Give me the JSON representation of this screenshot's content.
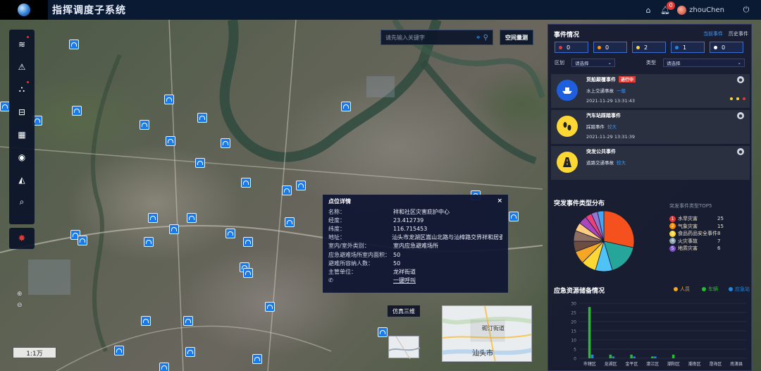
{
  "app": {
    "title": "指挥调度子系统",
    "user": "zhouChen",
    "notification_count": "0"
  },
  "search": {
    "placeholder": "请先输入关键字",
    "space_button": "空间量测"
  },
  "map": {
    "scale": "1:1万",
    "view_3d_button": "仿真三维",
    "minimap_city": "汕头市",
    "minimap_district": "砌汀街道"
  },
  "toolbar": {
    "tools": [
      "layers-icon",
      "warning-icon",
      "network-icon",
      "cabinet-icon",
      "grid-icon",
      "globe-icon",
      "camera-icon",
      "monitor-search-icon"
    ],
    "alarm": "alarm-icon"
  },
  "detail": {
    "title": "点位详情",
    "close": "×",
    "rows": [
      {
        "key": "名称：",
        "val": "祥和社区灾害庇护中心"
      },
      {
        "key": "经度：",
        "val": "23.412739"
      },
      {
        "key": "纬度：",
        "val": "116.715453"
      },
      {
        "key": "地址：",
        "val": "汕头市龙湖区嵩山北路与汕樟路交界祥和居委"
      },
      {
        "key": "室内/室外类别：",
        "val": "室内应急避难场所"
      },
      {
        "key": "应急避难场所室内面积：",
        "val": "50"
      },
      {
        "key": "避难所容纳人数：",
        "val": "50"
      },
      {
        "key": "主管单位：",
        "val": "龙祥街道"
      }
    ],
    "phone_link": "一键呼叫"
  },
  "events_panel": {
    "title": "事件情况",
    "tabs": [
      "当前事件",
      "历史事件"
    ],
    "stats": [
      {
        "value": "0",
        "color": "#e53935"
      },
      {
        "value": "0",
        "color": "#ff9800"
      },
      {
        "value": "2",
        "color": "#fdd835"
      },
      {
        "value": "1",
        "color": "#1e88e5"
      },
      {
        "value": "0",
        "color": "#ffffff"
      }
    ],
    "filter_region_label": "区划",
    "filter_type_label": "类型",
    "select_placeholder": "请选择",
    "events": [
      {
        "name": "货船颠覆事件",
        "status": "进行中",
        "type": "水上交通事故",
        "link": "一般",
        "time": "2021-11-29 13:31:43"
      },
      {
        "name": "汽车站踩踏事件",
        "status": "",
        "type": "踩踏事件",
        "link": "较大",
        "time": "2021-11-29 13:31:39"
      },
      {
        "name": "突发公共事件",
        "status": "",
        "type": "道路交通事故",
        "link": "较大",
        "time": ""
      }
    ]
  },
  "distribution": {
    "title": "突发事件类型分布",
    "top5_title": "突发事件类型TOP5",
    "top5": [
      {
        "rank": "1",
        "name": "水旱灾害",
        "value": "25",
        "color": "#e53935"
      },
      {
        "rank": "2",
        "name": "气象灾害",
        "value": "15",
        "color": "#fb8c00"
      },
      {
        "rank": "3",
        "name": "食品药品安全事件",
        "value": "8",
        "color": "#fdd835"
      },
      {
        "rank": "4",
        "name": "火灾事故",
        "value": "7",
        "color": "#90a4ae"
      },
      {
        "rank": "5",
        "name": "地质灾害",
        "value": "6",
        "color": "#7e57c2"
      }
    ]
  },
  "resources": {
    "title": "应急资源储备情况",
    "legend": [
      {
        "name": "人员",
        "color": "#f5a623"
      },
      {
        "name": "车辆",
        "color": "#21c12a"
      },
      {
        "name": "应急站",
        "color": "#1e88e5"
      }
    ]
  },
  "chart_data": [
    {
      "type": "pie",
      "title": "突发事件类型分布",
      "slices": [
        {
          "value": 25,
          "color": "#f4511e"
        },
        {
          "value": 15,
          "color": "#26a69a"
        },
        {
          "value": 8,
          "color": "#4fc3f7"
        },
        {
          "value": 7,
          "color": "#fdd835"
        },
        {
          "value": 6,
          "color": "#f5a623"
        },
        {
          "value": 5,
          "color": "#6d4c41"
        },
        {
          "value": 5,
          "color": "#8d6e63"
        },
        {
          "value": 4,
          "color": "#ffcc80"
        },
        {
          "value": 4,
          "color": "#ab47bc"
        },
        {
          "value": 3,
          "color": "#ec407a"
        },
        {
          "value": 3,
          "color": "#9575cd"
        },
        {
          "value": 3,
          "color": "#42a5f5"
        }
      ]
    },
    {
      "type": "bar",
      "title": "应急资源储备情况",
      "categories": [
        "市辖区",
        "龙湖区",
        "金平区",
        "濠江区",
        "潮阳区",
        "潮南区",
        "澄海区",
        "南澳县"
      ],
      "series": [
        {
          "name": "人员",
          "color": "#f5a623",
          "values": [
            0,
            0,
            0,
            0,
            0,
            0,
            0,
            0
          ]
        },
        {
          "name": "车辆",
          "color": "#21c12a",
          "values": [
            28,
            2,
            2,
            1,
            2,
            0,
            0,
            0
          ]
        },
        {
          "name": "应急站",
          "color": "#1e88e5",
          "values": [
            2,
            1,
            1,
            1,
            0,
            0,
            0,
            0
          ]
        }
      ],
      "yticks": [
        "30",
        "25",
        "20",
        "15",
        "10",
        "5",
        "0"
      ],
      "ylim": [
        0,
        30
      ]
    }
  ]
}
